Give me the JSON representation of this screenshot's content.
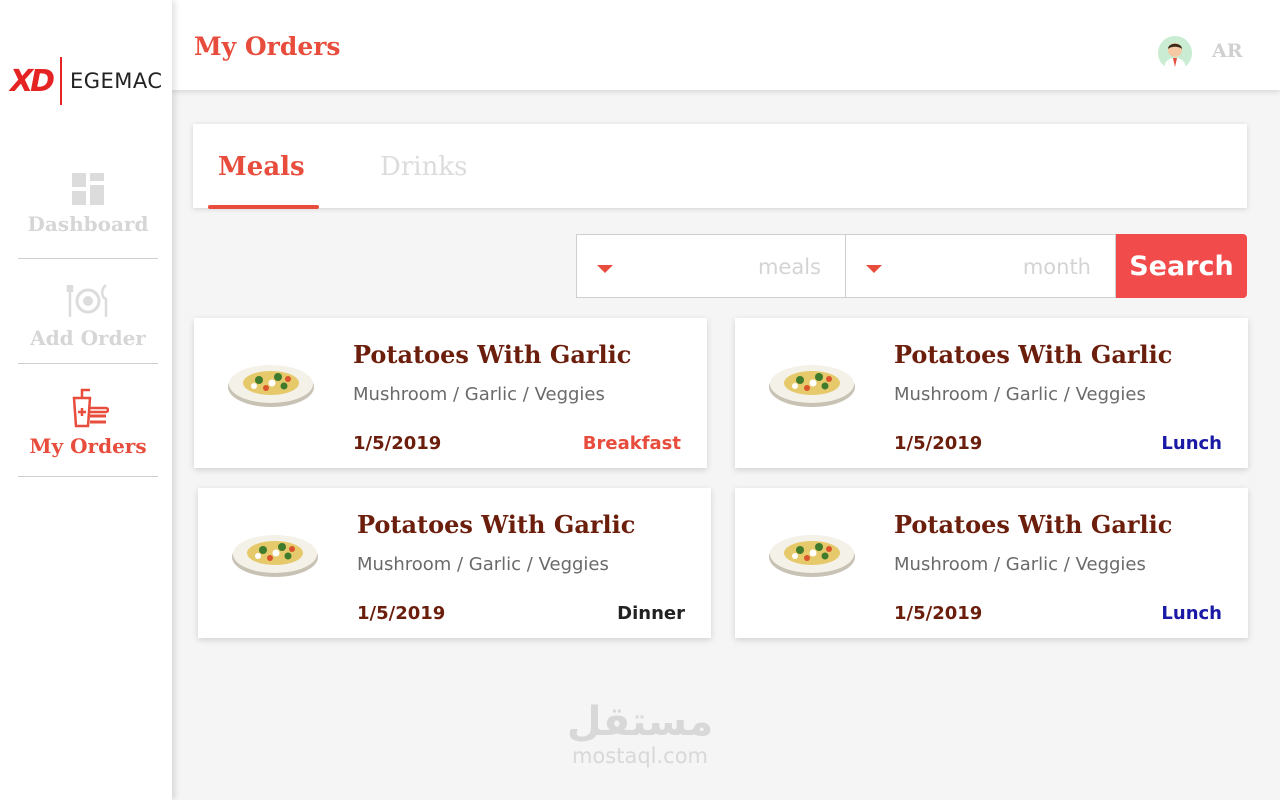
{
  "brand": {
    "mark": "XD",
    "name": "EGEMAC",
    "accent_color": "#e74c3c"
  },
  "sidebar": {
    "items": [
      {
        "label": "Dashboard",
        "icon": "dashboard-icon",
        "active": false
      },
      {
        "label": "Add Order",
        "icon": "dining-icon",
        "active": false
      },
      {
        "label": "My Orders",
        "icon": "orders-icon",
        "active": true
      }
    ]
  },
  "header": {
    "title": "My Orders",
    "lang": "AR",
    "avatar_icon": "user-avatar-icon"
  },
  "tabs": [
    {
      "label": "Meals",
      "active": true
    },
    {
      "label": "Drinks",
      "active": false
    }
  ],
  "search": {
    "meals_placeholder": "meals",
    "month_placeholder": "month",
    "button_label": "Search"
  },
  "orders": [
    {
      "title": "Potatoes With Garlic",
      "ingredients": "Mushroom / Garlic / Veggies",
      "date": "1/5/2019",
      "meal_type": "Breakfast",
      "meal_type_color": "#e74c3c"
    },
    {
      "title": "Potatoes With Garlic",
      "ingredients": "Mushroom / Garlic / Veggies",
      "date": "1/5/2019",
      "meal_type": "Lunch",
      "meal_type_color": "#1a1aa6"
    },
    {
      "title": "Potatoes With Garlic",
      "ingredients": "Mushroom / Garlic / Veggies",
      "date": "1/5/2019",
      "meal_type": "Dinner",
      "meal_type_color": "#222222"
    },
    {
      "title": "Potatoes With Garlic",
      "ingredients": "Mushroom / Garlic / Veggies",
      "date": "1/5/2019",
      "meal_type": "Lunch",
      "meal_type_color": "#1a1aa6"
    }
  ],
  "watermark": {
    "arabic": "مستقل",
    "latin": "mostaql.com"
  }
}
